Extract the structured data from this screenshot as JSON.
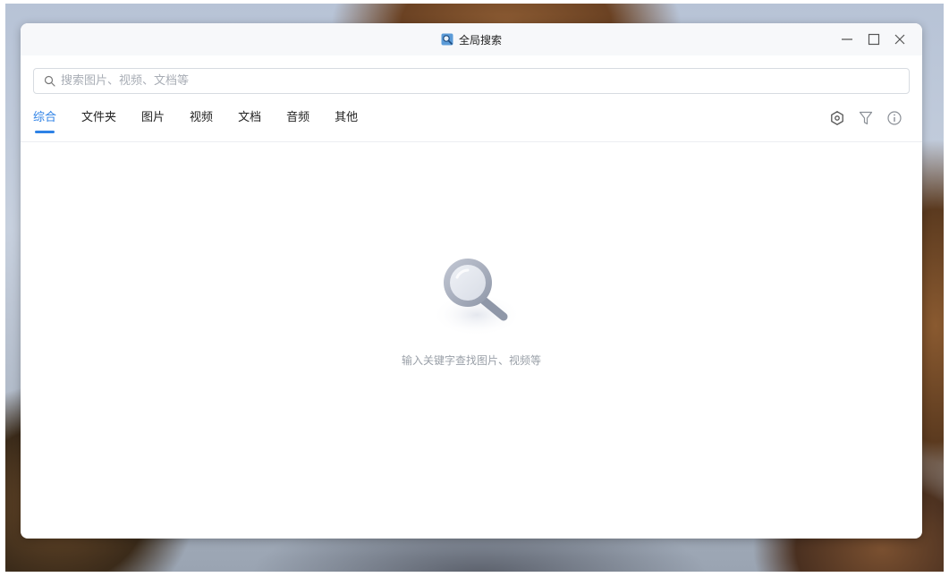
{
  "window": {
    "title": "全局搜索",
    "app_icon": "search-app-icon",
    "controls": {
      "minimize": "minimize-icon",
      "maximize": "maximize-icon",
      "close": "close-icon"
    }
  },
  "search": {
    "placeholder": "搜索图片、视频、文档等",
    "value": ""
  },
  "tabs": [
    {
      "label": "综合",
      "active": true
    },
    {
      "label": "文件夹",
      "active": false
    },
    {
      "label": "图片",
      "active": false
    },
    {
      "label": "视频",
      "active": false
    },
    {
      "label": "文档",
      "active": false
    },
    {
      "label": "音频",
      "active": false
    },
    {
      "label": "其他",
      "active": false
    }
  ],
  "toolbar": {
    "icons": [
      "settings-icon",
      "filter-icon",
      "info-icon"
    ]
  },
  "empty_state": {
    "message": "输入关键字查找图片、视频等",
    "illustration": "magnifier-illustration"
  },
  "colors": {
    "accent": "#2e82e6",
    "placeholder": "#a8adb5",
    "muted_text": "#9aa0a8"
  }
}
